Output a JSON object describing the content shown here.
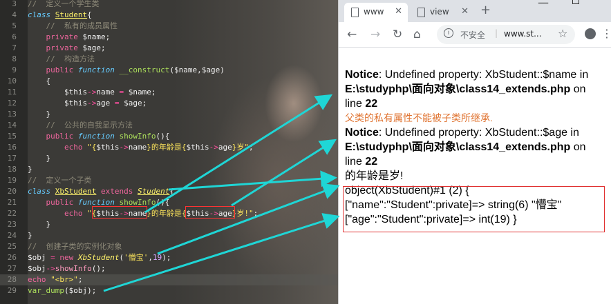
{
  "editor": {
    "lines": [
      {
        "n": "3",
        "html": "<span class='comment'>//  定义一个学生类</span>"
      },
      {
        "n": "4",
        "html": "<span class='kwi'>class</span> <span class='type'>Student</span><span class='op'>{</span>"
      },
      {
        "n": "5",
        "html": "    <span class='comment'>//  私有的成员属性</span>"
      },
      {
        "n": "6",
        "html": "    <span class='kw'>private</span> <span class='var'>$name</span><span class='op'>;</span>"
      },
      {
        "n": "7",
        "html": "    <span class='kw'>private</span> <span class='var'>$age</span><span class='op'>;</span>"
      },
      {
        "n": "8",
        "html": "    <span class='comment'>//  构造方法</span>"
      },
      {
        "n": "9",
        "html": "    <span class='kw'>public</span> <span class='kwi'>function</span> <span class='fn'>__construct</span><span class='op'>($name,$age)</span>"
      },
      {
        "n": "10",
        "html": "    <span class='op'>{</span>"
      },
      {
        "n": "11",
        "html": "        <span class='var'>$this</span><span class='pink'>-&gt;</span><span class='var'>name</span> <span class='pink'>=</span> <span class='var'>$name</span><span class='op'>;</span>"
      },
      {
        "n": "12",
        "html": "        <span class='var'>$this</span><span class='pink'>-&gt;</span><span class='var'>age</span> <span class='pink'>=</span> <span class='var'>$age</span><span class='op'>;</span>"
      },
      {
        "n": "13",
        "html": "    <span class='op'>}</span>"
      },
      {
        "n": "14",
        "html": "    <span class='comment'>//  公共的自我显示方法</span>"
      },
      {
        "n": "15",
        "html": "    <span class='kw'>public</span> <span class='kwi'>function</span> <span class='fn'>showInfo</span><span class='op'>(){</span>"
      },
      {
        "n": "16",
        "html": "        <span class='kw'>echo</span> <span class='str'>\"{</span><span class='var'>$this</span><span class='pink'>-&gt;</span><span class='var'>name</span><span class='str'>}的年龄是{</span><span class='var'>$this</span><span class='pink'>-&gt;</span><span class='var'>age</span><span class='str'>}岁\"</span><span class='op'>;</span>"
      },
      {
        "n": "17",
        "html": "    <span class='op'>}</span>"
      },
      {
        "n": "18",
        "html": "<span class='op'>}</span>"
      },
      {
        "n": "19",
        "html": "<span class='comment'>//  定义一个子类</span>"
      },
      {
        "n": "20",
        "html": "<span class='kwi'>class</span> <span class='type'>XbStudent</span> <span class='kw'>extends</span> <span class='type2'><i><u>Student</u></i></span><span class='op'>{</span>"
      },
      {
        "n": "21",
        "html": "    <span class='kw'>public</span> <span class='kwi'>function</span> <span class='fn'>showInfo</span><span class='op'>(){</span>"
      },
      {
        "n": "22",
        "html": "        <span class='kw'>echo</span> <span class='str'>\"{</span><span class='var'>$this</span><span class='pink'>-&gt;</span><span class='var'>name</span><span class='str'>}的年龄是{</span><span class='var'>$this</span><span class='pink'>-&gt;</span><span class='var'>age</span><span class='str'>}岁!\"</span><span class='op'>;</span>"
      },
      {
        "n": "23",
        "html": "    <span class='op'>}</span>"
      },
      {
        "n": "24",
        "html": "<span class='op'>}</span>"
      },
      {
        "n": "25",
        "html": "<span class='comment'>//  创建子类的实例化对象</span>"
      },
      {
        "n": "26",
        "html": "<span class='var'>$obj</span> <span class='pink'>=</span> <span class='kw'>new</span> <span class='type2'><i>XbStudent</i></span><span class='op'>(</span><span class='str'>'懵宝'</span><span class='op'>,</span><span class='num'>19</span><span class='op'>);</span>"
      },
      {
        "n": "27",
        "html": "<span class='var'>$obj</span><span class='pink'>-&gt;</span><span class='fnc'>showInfo</span><span class='op'>();</span>"
      },
      {
        "n": "28",
        "html": "<span class='kw'>echo</span> <span class='str'>\"&lt;br&gt;\"</span><span class='op'>;</span>",
        "current": true
      },
      {
        "n": "29",
        "html": "<span class='fn'>var_dump</span><span class='op'>($obj);</span>"
      }
    ]
  },
  "browser": {
    "tabs": [
      {
        "title": "www",
        "active": true
      },
      {
        "title": "view",
        "active": false
      }
    ],
    "new_tab": "+",
    "security_label": "不安全",
    "url": "www.st...",
    "output": {
      "notice_label": "Notice",
      "notice1_msg": ": Undefined property: XbStudent::$name in",
      "file_path": "E:\\studyphp\\面向对象\\class14_extends.php",
      "on_text": " on",
      "line_label": "line ",
      "line_no": "22",
      "annotation": "父类的私有属性不能被子类所继承.",
      "notice2_msg": ": Undefined property: XbStudent::$age in",
      "echo_result": "的年龄是岁!",
      "dump_line1": "object(XbStudent)#1 (2) {",
      "dump_line2": "[\"name\":\"Student\":private]=> string(6) \"懵宝\"",
      "dump_line3": "[\"age\":\"Student\":private]=> int(19) }"
    }
  },
  "colors": {
    "editor_bg": "#3b3a37",
    "arrow": "#1fd6d6",
    "annotation": "#e07432",
    "box": "#e03030"
  }
}
